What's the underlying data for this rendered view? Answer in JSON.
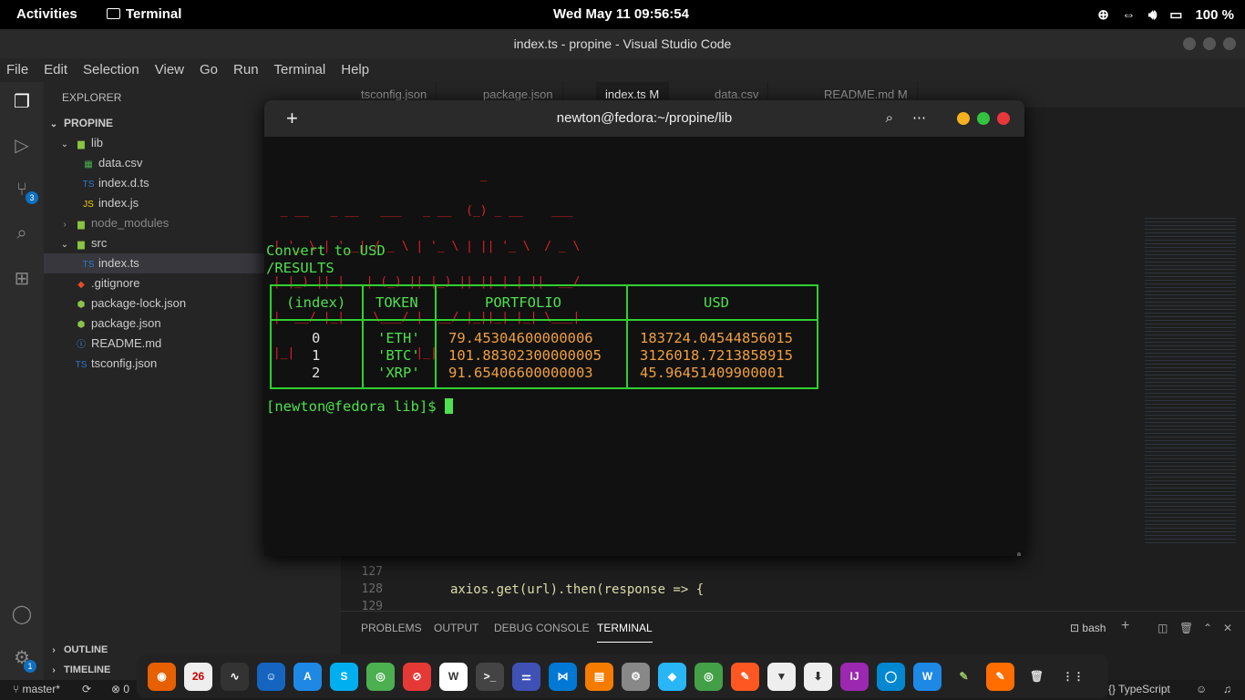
{
  "topbar": {
    "activities": "Activities",
    "app": "Terminal",
    "clock": "Wed May 11  09:56:54",
    "battery": "100 %"
  },
  "window": {
    "title": "index.ts - propine - Visual Studio Code"
  },
  "menu": [
    "File",
    "Edit",
    "Selection",
    "View",
    "Go",
    "Run",
    "Terminal",
    "Help"
  ],
  "activity_badges": {
    "scm": "3",
    "settings": "1"
  },
  "explorer": {
    "header": "EXPLORER",
    "project": "PROPINE",
    "items": [
      {
        "label": "lib",
        "kind": "folder-open"
      },
      {
        "label": "data.csv",
        "kind": "csv"
      },
      {
        "label": "index.d.ts",
        "kind": "ts"
      },
      {
        "label": "index.js",
        "kind": "js"
      },
      {
        "label": "node_modules",
        "kind": "folder"
      },
      {
        "label": "src",
        "kind": "folder-open"
      },
      {
        "label": "index.ts",
        "kind": "ts"
      },
      {
        "label": ".gitignore",
        "kind": "git"
      },
      {
        "label": "package-lock.json",
        "kind": "json"
      },
      {
        "label": "package.json",
        "kind": "json"
      },
      {
        "label": "README.md",
        "kind": "info"
      },
      {
        "label": "tsconfig.json",
        "kind": "ts"
      }
    ],
    "outline": "OUTLINE",
    "timeline": "TIMELINE"
  },
  "tabs": [
    "tsconfig.json",
    "package.json",
    "index.ts M",
    "data.csv",
    "README.md M"
  ],
  "code": {
    "lines": [
      {
        "n": "127",
        "t": ""
      },
      {
        "n": "128",
        "t": "axios.get(url).then(response => {"
      },
      {
        "n": "129",
        "t": ""
      }
    ]
  },
  "panel": {
    "tabs": [
      "PROBLEMS",
      "OUTPUT",
      "DEBUG CONSOLE",
      "TERMINAL"
    ],
    "shell": "bash"
  },
  "status": {
    "branch": "master*",
    "errors": "0",
    "language": "TypeScript"
  },
  "terminal": {
    "title": "newton@fedora:~/propine/lib",
    "ascii": [
      "                              _                  ",
      "  _ __   _ __   ___   _ __  (_) _ __    ___     ",
      " | '_ \\ | '__| / _ \\ | '_ \\ | || '_ \\  / _ \\    ",
      " | |_) || |   | (_) || |_) || || | | ||  __/    ",
      " | .__/ |_|    \\___/ | .__/ |_||_| |_| \\___|    ",
      " |_|                 |_|                         "
    ],
    "line1": "Convert to USD",
    "line2": "/RESULTS",
    "table": {
      "headers": [
        "(index)",
        "TOKEN",
        "PORTFOLIO",
        "USD"
      ],
      "rows": [
        [
          "0",
          "'ETH'",
          "79.45304600000006",
          "183724.04544856015"
        ],
        [
          "1",
          "'BTC'",
          "101.88302300000005",
          "3126018.7213858915"
        ],
        [
          "2",
          "'XRP'",
          "91.65406600000003",
          "45.96451409900001"
        ]
      ]
    },
    "prompt": "[newton@fedora lib]$ "
  },
  "colors": {
    "accent": "#0e70c0",
    "term_green": "#4ee04e",
    "term_red": "#e0202a",
    "string_orange": "#ce9178"
  }
}
